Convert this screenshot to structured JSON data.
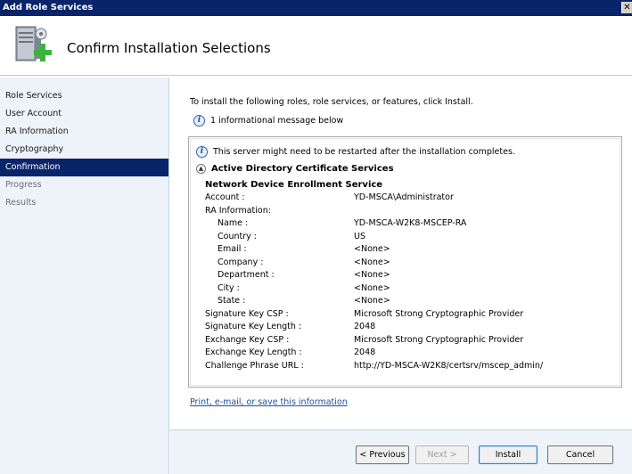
{
  "window": {
    "title": "Add Role Services",
    "close_glyph": "✕"
  },
  "header": {
    "title": "Confirm Installation Selections",
    "icon": "server-add-icon"
  },
  "sidebar": {
    "items": [
      {
        "label": "Role Services",
        "state": "done"
      },
      {
        "label": "User Account",
        "state": "done"
      },
      {
        "label": "RA Information",
        "state": "done"
      },
      {
        "label": "Cryptography",
        "state": "done"
      },
      {
        "label": "Confirmation",
        "state": "active"
      },
      {
        "label": "Progress",
        "state": "pending"
      },
      {
        "label": "Results",
        "state": "pending"
      }
    ]
  },
  "main": {
    "instruction": "To install the following roles, role services, or features, click Install.",
    "info_message": "1 informational message below",
    "details": {
      "restart_note": "This server might need to be restarted after the installation completes.",
      "section_title": "Active Directory Certificate Services",
      "service_title": "Network Device Enrollment Service",
      "rows": [
        {
          "key": "Account :",
          "value": "YD-MSCA\\Administrator"
        },
        {
          "key": "RA Information:",
          "value": ""
        },
        {
          "key": "Name :",
          "value": "YD-MSCA-W2K8-MSCEP-RA"
        },
        {
          "key": "Country :",
          "value": "US"
        },
        {
          "key": "Email :",
          "value": "<None>"
        },
        {
          "key": "Company :",
          "value": "<None>"
        },
        {
          "key": "Department :",
          "value": "<None>"
        },
        {
          "key": "City :",
          "value": "<None>"
        },
        {
          "key": "State :",
          "value": "<None>"
        },
        {
          "key": "Signature Key CSP :",
          "value": "Microsoft Strong Cryptographic Provider"
        },
        {
          "key": "Signature Key Length :",
          "value": "2048"
        },
        {
          "key": "Exchange Key CSP :",
          "value": "Microsoft Strong Cryptographic Provider"
        },
        {
          "key": "Exchange Key Length :",
          "value": "2048"
        },
        {
          "key": "Challenge Phrase URL :",
          "value": "http://YD-MSCA-W2K8/certsrv/mscep_admin/"
        }
      ]
    },
    "link": "Print, e-mail, or save this information"
  },
  "footer": {
    "previous": "< Previous",
    "next": "Next >",
    "install": "Install",
    "cancel": "Cancel"
  },
  "colors": {
    "titlebar": "#0a246a",
    "sidebar_bg": "#eef2f9",
    "active_nav": "#0a246a",
    "link": "#1f4fa0"
  }
}
